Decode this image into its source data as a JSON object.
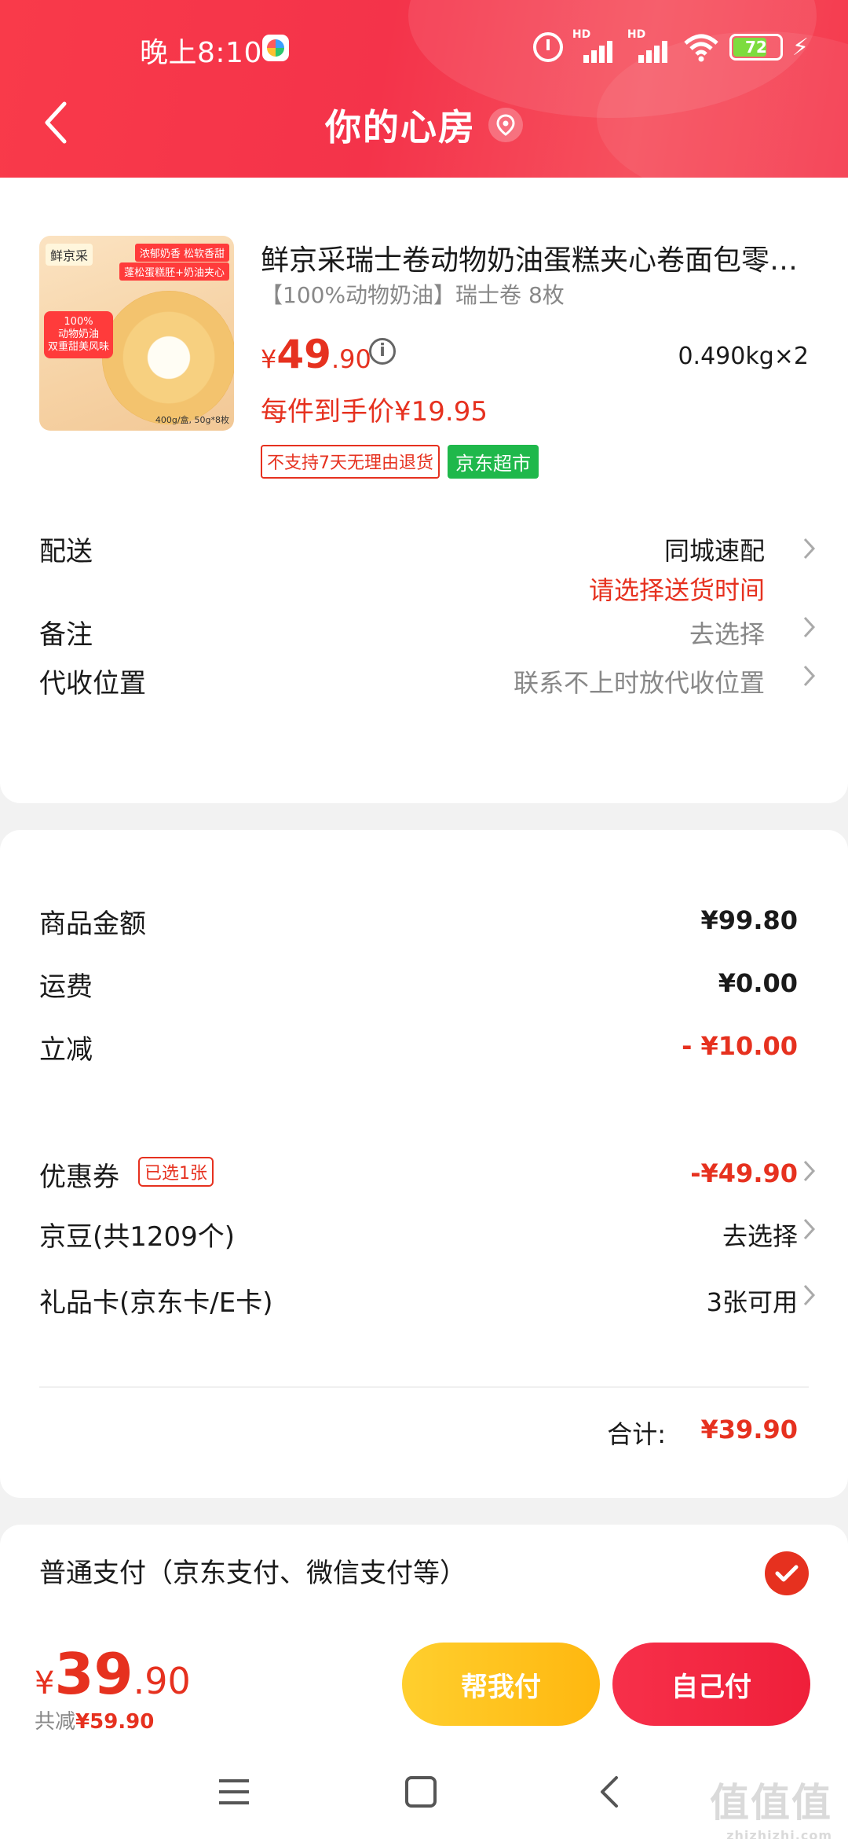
{
  "status_bar": {
    "time": "晚上8:10",
    "battery": "72",
    "network": "HD"
  },
  "header": {
    "title": "你的心房"
  },
  "product": {
    "title": "鲜京采瑞士卷动物奶油蛋糕夹心卷面包零食早餐",
    "subtitle": "【100%动物奶油】瑞士卷 8枚",
    "price_currency": "¥",
    "price_int": "49",
    "price_dec": ".90",
    "quantity": "0.490kg×2",
    "each_price": "每件到手价¥19.95",
    "tag_no_return": "不支持7天无理由退货",
    "tag_store": "京东超市",
    "thumb": {
      "brand": "鲜京采",
      "tag1": "浓郁奶香 松软香甜",
      "tag2": "蓬松蛋糕胚+奶油夹心",
      "badge_line1": "100%",
      "badge_line2": "动物奶油",
      "badge_line3": "双重甜美风味",
      "spec": "400g/盒, 50g*8枚"
    }
  },
  "delivery": {
    "label": "配送",
    "value": "同城速配",
    "hint": "请选择送货时间"
  },
  "note": {
    "label": "备注",
    "value": "去选择"
  },
  "collect": {
    "label": "代收位置",
    "value": "联系不上时放代收位置"
  },
  "price_detail": {
    "goods": {
      "label": "商品金额",
      "value": "¥99.80"
    },
    "shipping": {
      "label": "运费",
      "value": "¥0.00"
    },
    "discount": {
      "label": "立减",
      "value": "- ¥10.00"
    },
    "coupon": {
      "label": "优惠券",
      "tag": "已选1张",
      "value": "-¥49.90"
    },
    "jingdou": {
      "label": "京豆(共1209个)",
      "value": "去选择"
    },
    "giftcard": {
      "label": "礼品卡(京东卡/E卡)",
      "value": "3张可用"
    },
    "total_label": "合计:",
    "total_value": "¥39.90"
  },
  "payment": {
    "method": "普通支付（京东支付、微信支付等）"
  },
  "bottom": {
    "currency": "¥",
    "total_int": "39",
    "total_dec": ".90",
    "saved_label": "共减",
    "saved_value": "¥59.90",
    "help_pay": "帮我付",
    "self_pay": "自己付"
  },
  "watermark": {
    "main": "值值值",
    "sub": "zhizhizhi.com"
  },
  "colors": {
    "brand_red": "#e6311f",
    "header_red": "#f4334a",
    "help_yellow": "#ffc21f",
    "store_green": "#1fb84b"
  }
}
